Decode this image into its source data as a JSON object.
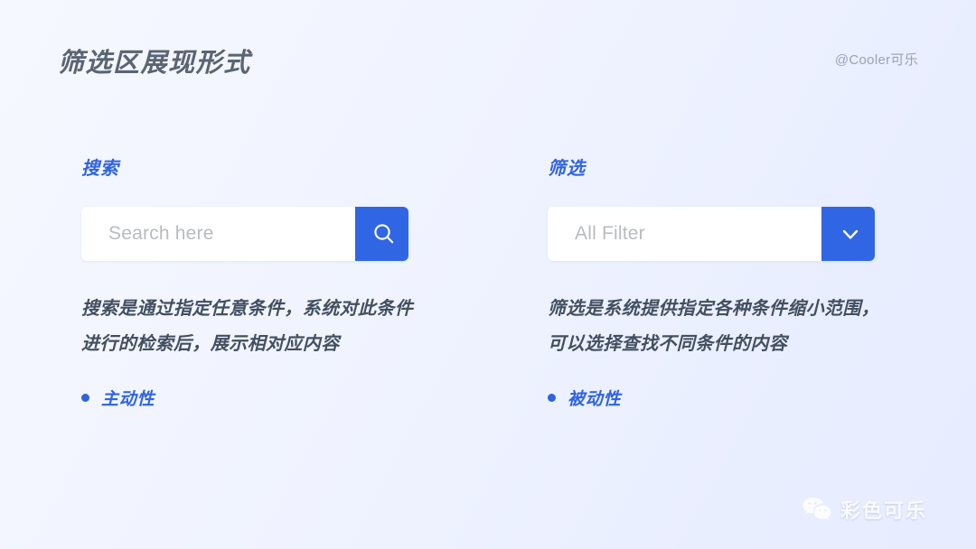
{
  "header": {
    "title": "筛选区展现形式",
    "attribution": "@Cooler可乐"
  },
  "colors": {
    "accent_blue": "#3066e3",
    "heading_blue": "#2f63e0",
    "title_gray": "#5a6472",
    "body_slate": "#424f60",
    "placeholder_gray": "#b9bbbe",
    "bg_light": "#f6f8ff",
    "bg_deep": "#e7ecff"
  },
  "columns": [
    {
      "heading": "搜索",
      "control": {
        "type": "search-input",
        "placeholder": "Search here",
        "value": "",
        "action_icon": "search-icon"
      },
      "description": "搜索是通过指定任意条件，系统对此条件进行的检索后，展示相对应内容",
      "bullet": {
        "marker": "●",
        "label": "主动性"
      }
    },
    {
      "heading": "筛选",
      "control": {
        "type": "filter-select",
        "placeholder": "All Filter",
        "value": "",
        "action_icon": "chevron-down-icon"
      },
      "description": "筛选是系统提供指定各种条件缩小范围，可以选择查找不同条件的内容",
      "bullet": {
        "marker": "●",
        "label": "被动性"
      }
    }
  ],
  "watermark": {
    "icon": "wechat-icon",
    "text": "彩色可乐"
  }
}
